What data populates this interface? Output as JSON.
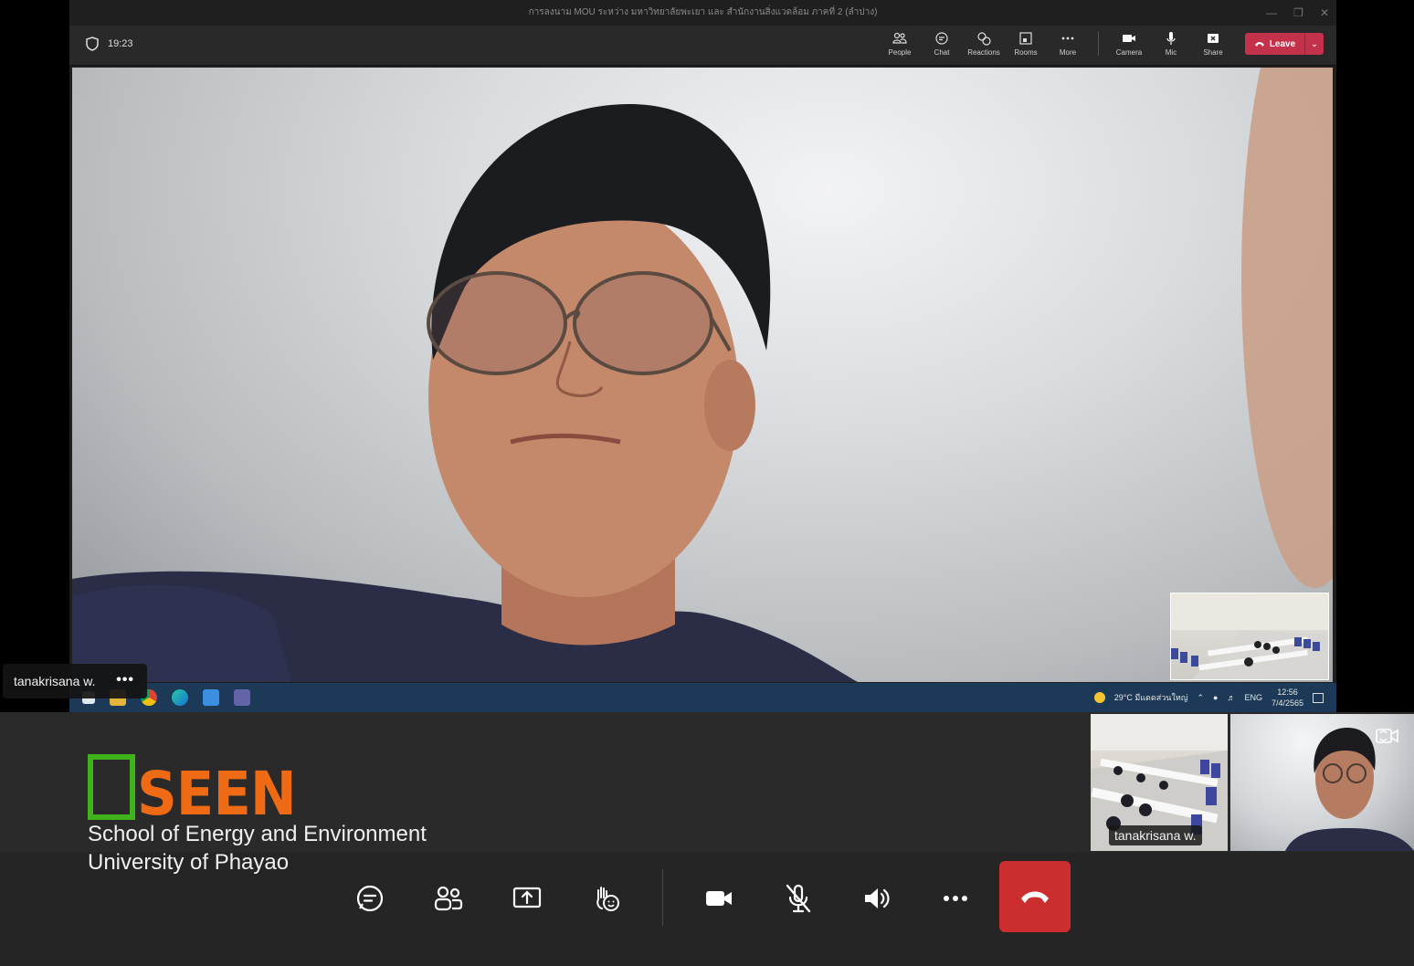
{
  "shared_window": {
    "title": "การลงนาม MOU ระหว่าง มหาวิทยาลัยพะเยา และ สำนักงานสิ่งแวดล้อม ภาคที่ 2 (ลำปาง)",
    "meeting_time": "19:23",
    "toolbar": {
      "people": "People",
      "chat": "Chat",
      "reactions": "Reactions",
      "rooms": "Rooms",
      "more": "More",
      "camera": "Camera",
      "mic": "Mic",
      "share": "Share",
      "leave": "Leave"
    },
    "taskbar": {
      "weather": "29°C มีแดดส่วนใหญ่",
      "lang": "ENG",
      "time": "12:56",
      "date": "7/4/2565"
    }
  },
  "main_participant": {
    "name": "tanakrisana w."
  },
  "tiles": [
    {
      "name": "tanakrisana w."
    }
  ],
  "logo": {
    "brand": "SEEN",
    "line1": "School of Energy and Environment",
    "line2": "University of Phayao",
    "colors": {
      "box": "#3fb21c",
      "text": "#ee6a14"
    }
  },
  "controls": {
    "icons": [
      "chat-icon",
      "people-icon",
      "share-screen-icon",
      "raise-hand-icon",
      "camera-icon",
      "mic-off-icon",
      "speaker-icon",
      "more-icon",
      "hangup-icon"
    ],
    "hangup_color": "#cc2d2e"
  }
}
